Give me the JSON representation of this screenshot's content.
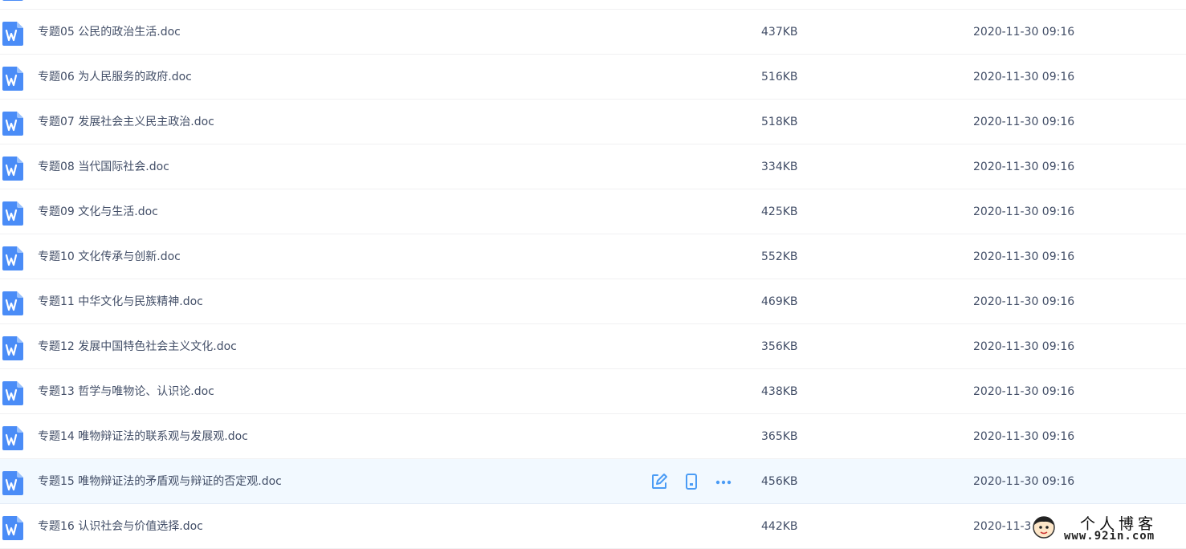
{
  "files": [
    {
      "name": "",
      "size": "",
      "date": ""
    },
    {
      "name": "专题05 公民的政治生活.doc",
      "size": "437KB",
      "date": "2020-11-30 09:16"
    },
    {
      "name": "专题06 为人民服务的政府.doc",
      "size": "516KB",
      "date": "2020-11-30 09:16"
    },
    {
      "name": "专题07 发展社会主义民主政治.doc",
      "size": "518KB",
      "date": "2020-11-30 09:16"
    },
    {
      "name": "专题08 当代国际社会.doc",
      "size": "334KB",
      "date": "2020-11-30 09:16"
    },
    {
      "name": "专题09 文化与生活.doc",
      "size": "425KB",
      "date": "2020-11-30 09:16"
    },
    {
      "name": "专题10 文化传承与创新.doc",
      "size": "552KB",
      "date": "2020-11-30 09:16"
    },
    {
      "name": "专题11 中华文化与民族精神.doc",
      "size": "469KB",
      "date": "2020-11-30 09:16"
    },
    {
      "name": "专题12 发展中国特色社会主义文化.doc",
      "size": "356KB",
      "date": "2020-11-30 09:16"
    },
    {
      "name": "专题13 哲学与唯物论、认识论.doc",
      "size": "438KB",
      "date": "2020-11-30 09:16"
    },
    {
      "name": "专题14 唯物辩证法的联系观与发展观.doc",
      "size": "365KB",
      "date": "2020-11-30 09:16"
    },
    {
      "name": "专题15 唯物辩证法的矛盾观与辩证的否定观.doc",
      "size": "456KB",
      "date": "2020-11-30 09:16"
    },
    {
      "name": "专题16 认识社会与价值选择.doc",
      "size": "442KB",
      "date": "2020-11-3"
    }
  ],
  "hovered_index": 11,
  "row_action_icons": [
    "edit-icon",
    "phone-icon",
    "more-icon"
  ],
  "file_icon": "word-doc-icon",
  "colors": {
    "icon_blue": "#4a8cf7",
    "action_blue": "#4b9cf5",
    "hover_bg": "#f2f9ff",
    "text": "#424e67"
  },
  "watermark": {
    "title": "个人博客",
    "url": "www.92in.com"
  }
}
